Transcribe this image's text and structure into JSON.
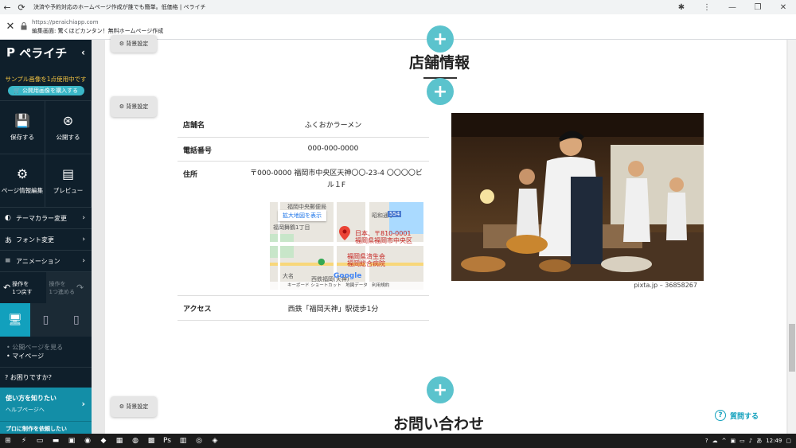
{
  "browser": {
    "tab_title": "決済や予約対応のホームページ作成が誰でも簡単。低価格 | ペライチ",
    "url": "https://peraichiapp.com",
    "page_title": "編集画面: 驚くほどカンタン！無料ホームページ作成",
    "back_icon": "←",
    "reload_icon": "⟳",
    "close_icon": "✕",
    "lock_icon": "🔒",
    "menu_icon": "⋮",
    "minimize_icon": "—",
    "restore_icon": "❐",
    "window_close_icon": "✕",
    "extension_icon": "✱"
  },
  "sidebar": {
    "brand": "ペライチ",
    "collapse_icon": "‹",
    "sample_note": "サンプル画像を1点使用中です",
    "buy_button": "🛒 公開用画像を購入する",
    "save": "保存する",
    "publish": "公開する",
    "page_info": "ページ情報編集",
    "preview": "プレビュー",
    "theme_color": "テーマカラー変更",
    "font_change": "フォント変更",
    "animation": "アニメーション",
    "undo_line1": "操作を",
    "undo_line2": "1つ戻す",
    "redo_line1": "操作を",
    "redo_line2": "1つ進める",
    "view_public": "公開ページを見る",
    "my_page": "マイページ",
    "help": "お困りですか？",
    "howto_title": "使い方を知りたい",
    "howto_sub": "ヘルプページへ",
    "pro_text": "プロに制作を依頼したい"
  },
  "editor": {
    "bg_settings": "背景設定",
    "section_title": "店舗情報",
    "next_section_title": "お問い合わせ",
    "ask_button": "質問する",
    "table": [
      {
        "key": "店舗名",
        "value": "ふくおかラーメン"
      },
      {
        "key": "電話番号",
        "value": "000-000-0000"
      },
      {
        "key": "住所",
        "value": "〒000-0000 福岡市中央区天神〇〇-23-4 〇〇〇〇ビル１F"
      },
      {
        "key": "アクセス",
        "value": "西鉄「福岡天神」駅徒歩1分"
      }
    ],
    "map": {
      "enlarge": "拡大地図を表示",
      "post_office": "福岡中央郵便局",
      "station": "福岡舞鶴1丁目",
      "showa": "昭和通り",
      "route": "554",
      "japan_label1": "日本、〒810-0001",
      "japan_label2": "福岡県福岡市中央区",
      "hospital1": "福岡県済生会",
      "hospital2": "福岡総合病院",
      "omiya": "大名",
      "tenjin": "西鉄福岡(天神)",
      "google": "Google",
      "footer": "キーボード ショートカット　地図データ　利用規約"
    },
    "photo_credit": "pixta.jp – 36858267"
  },
  "taskbar": {
    "time": "12:49",
    "ime": "あ"
  },
  "colors": {
    "sidebar_bg": "#0f1f2b",
    "accent": "#13a1bd",
    "plus": "#5bc3cd",
    "sample_yellow": "#f5c542"
  }
}
